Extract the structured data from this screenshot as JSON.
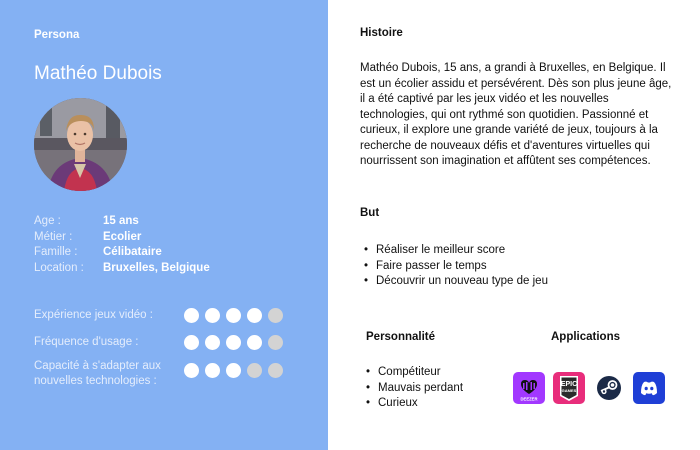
{
  "persona": {
    "label": "Persona",
    "name": "Mathéo Dubois",
    "facts": [
      {
        "label": "Age :",
        "value": "15 ans"
      },
      {
        "label": "Métier :",
        "value": "Ecolier"
      },
      {
        "label": "Famille :",
        "value": "Célibataire"
      },
      {
        "label": "Location :",
        "value": "Bruxelles, Belgique"
      }
    ],
    "ratings": [
      {
        "label": "Expérience jeux vidéo :",
        "filled": 4,
        "max": 5
      },
      {
        "label": "Fréquence d'usage :",
        "filled": 4,
        "max": 5
      },
      {
        "label": "Capacité à s'adapter aux nouvelles technologies :",
        "filled": 3,
        "max": 5
      }
    ]
  },
  "histoire": {
    "title": "Histoire",
    "text": "Mathéo Dubois, 15 ans, a grandi à Bruxelles, en Belgique. Il est un écolier assidu et persévérent. Dès son plus jeune âge, il a été captivé par les jeux vidéo et les nouvelles technologies, qui ont rythmé son quotidien. Passionné et curieux, il explore une grande variété de jeux, toujours à la recherche de nouveaux défis et d'aventures virtuelles qui nourrissent son imagination et affûtent ses compétences."
  },
  "but": {
    "title": "But",
    "items": [
      "Réaliser le meilleur score",
      "Faire passer le temps",
      "Découvrir un nouveau type de jeu"
    ]
  },
  "personnalite": {
    "title": "Personnalité",
    "items": [
      "Compétiteur",
      "Mauvais perdant",
      "Curieux"
    ]
  },
  "applications": {
    "title": "Applications",
    "items": [
      {
        "name": "deezer",
        "icon": "deezer-icon",
        "color": "#a238ff",
        "logo_text": "DEEZER"
      },
      {
        "name": "epic-games",
        "icon": "epic-games-icon",
        "color": "#2a2a2a",
        "logo_text": "EPIC GAMES"
      },
      {
        "name": "steam",
        "icon": "steam-icon",
        "color": "#ffffff"
      },
      {
        "name": "discord",
        "icon": "discord-icon",
        "color": "#1f3fd6"
      }
    ]
  },
  "colors": {
    "left_panel": "#84b1f3",
    "dot_on": "#ffffff",
    "dot_off": "#d3d3d3"
  }
}
